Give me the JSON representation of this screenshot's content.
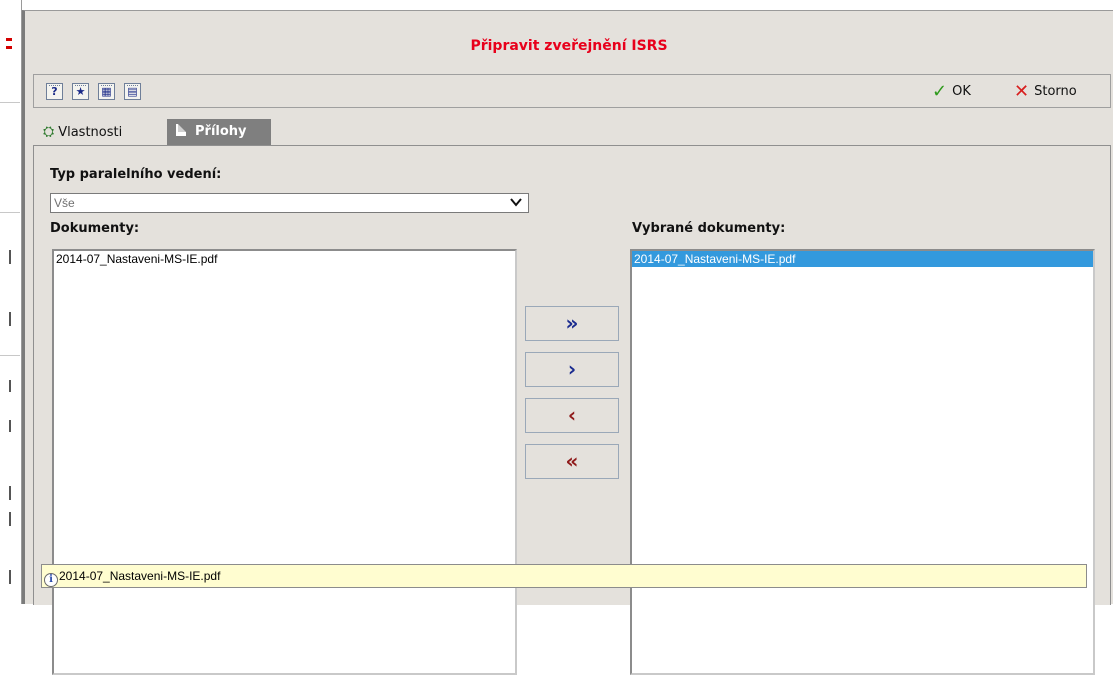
{
  "dialog": {
    "title": "Připravit zveřejnění ISRS"
  },
  "toolbar": {
    "icons": [
      {
        "name": "help-icon",
        "glyph": "?"
      },
      {
        "name": "favorite-icon",
        "glyph": "★"
      },
      {
        "name": "calendar-icon",
        "glyph": "▦"
      },
      {
        "name": "form-icon",
        "glyph": "▤"
      }
    ],
    "ok_label": "OK",
    "storno_label": "Storno"
  },
  "tabs": [
    {
      "label": "Vlastnosti",
      "active": false
    },
    {
      "label": "Přílohy",
      "active": true
    }
  ],
  "filter": {
    "label": "Typ paralelního vedení:",
    "selected": "Vše"
  },
  "documents": {
    "label": "Dokumenty:",
    "items": [
      "2014-07_Nastaveni-MS-IE.pdf"
    ]
  },
  "selected_documents": {
    "label": "Vybrané dokumenty:",
    "items": [
      "2014-07_Nastaveni-MS-IE.pdf"
    ]
  },
  "move_buttons": {
    "add_all": "»",
    "add_one": "›",
    "remove_one": "‹",
    "remove_all": "«"
  },
  "info": {
    "text": "2014-07_Nastaveni-MS-IE.pdf"
  },
  "colors": {
    "title": "#e8001b",
    "selection": "#3399dd",
    "dialog_bg": "#e4e1dc",
    "info_bg": "#fffdd0"
  }
}
